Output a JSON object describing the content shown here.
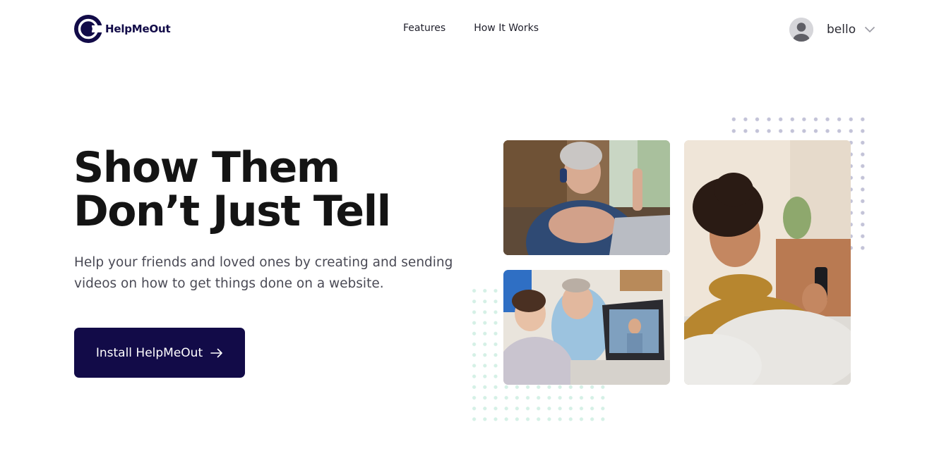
{
  "brand": {
    "name": "HelpMeOut",
    "color": "#120b48"
  },
  "nav": {
    "items": [
      {
        "label": "Features"
      },
      {
        "label": "How It Works"
      }
    ]
  },
  "user": {
    "name": "bello",
    "avatar_icon": "user-avatar-icon",
    "menu_icon": "chevron-down-icon"
  },
  "hero": {
    "headline_line1": "Show Them",
    "headline_line2": "Don’t Just Tell",
    "subtext": "Help your friends and loved ones by creating and sending videos on how to get things done on a website.",
    "cta": {
      "label": "Install HelpMeOut",
      "icon": "arrow-right-icon",
      "background": "#120b48"
    }
  },
  "images": [
    {
      "name": "woman-with-headphones-laptop-photo"
    },
    {
      "name": "boy-and-grandfather-video-call-photo"
    },
    {
      "name": "smiling-woman-with-phone-photo"
    }
  ]
}
